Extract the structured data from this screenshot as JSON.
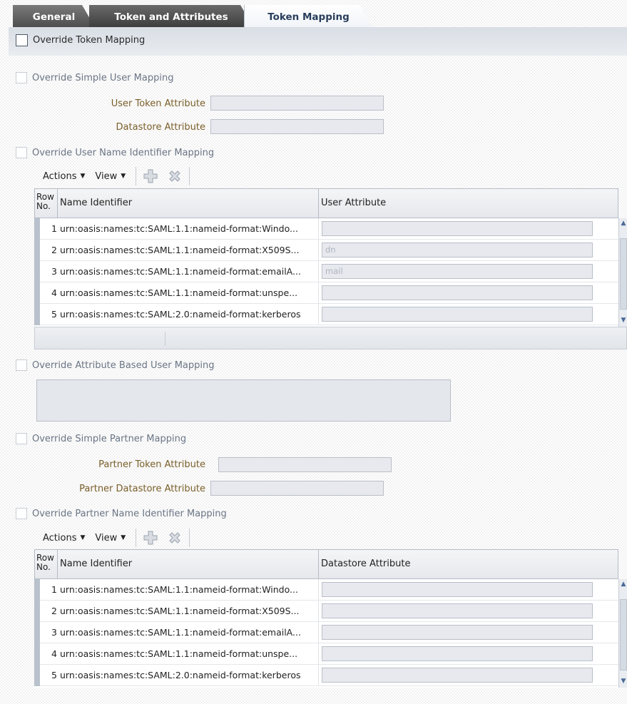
{
  "tabs": [
    {
      "label": "General"
    },
    {
      "label": "Token and Attributes"
    },
    {
      "label": "Token Mapping"
    }
  ],
  "override_token_mapping": {
    "label": "Override Token Mapping",
    "checked": false
  },
  "simple_user_mapping": {
    "label": "Override Simple User Mapping",
    "user_token_attribute_label": "User Token Attribute",
    "user_token_attribute_value": "",
    "datastore_attribute_label": "Datastore Attribute",
    "datastore_attribute_value": ""
  },
  "user_name_identifier_mapping": {
    "label": "Override User Name Identifier Mapping",
    "toolbar": {
      "actions": "Actions",
      "view": "View"
    },
    "columns": {
      "row_no": "Row No.",
      "name": "Name Identifier",
      "attr": "User Attribute"
    },
    "rows": [
      {
        "no": "1",
        "name": "urn:oasis:names:tc:SAML:1.1:nameid-format:Windo...",
        "value": ""
      },
      {
        "no": "2",
        "name": "urn:oasis:names:tc:SAML:1.1:nameid-format:X509S...",
        "value": "dn"
      },
      {
        "no": "3",
        "name": "urn:oasis:names:tc:SAML:1.1:nameid-format:emailA...",
        "value": "mail"
      },
      {
        "no": "4",
        "name": "urn:oasis:names:tc:SAML:1.1:nameid-format:unspe...",
        "value": ""
      },
      {
        "no": "5",
        "name": "urn:oasis:names:tc:SAML:2.0:nameid-format:kerberos",
        "value": ""
      }
    ]
  },
  "attribute_based_user_mapping": {
    "label": "Override Attribute Based User Mapping",
    "value": ""
  },
  "simple_partner_mapping": {
    "label": "Override Simple Partner Mapping",
    "partner_token_attribute_label": "Partner Token Attribute",
    "partner_token_attribute_value": "",
    "partner_datastore_attribute_label": "Partner Datastore Attribute",
    "partner_datastore_attribute_value": ""
  },
  "partner_name_identifier_mapping": {
    "label": "Override Partner Name Identifier Mapping",
    "toolbar": {
      "actions": "Actions",
      "view": "View"
    },
    "columns": {
      "row_no": "Row No.",
      "name": "Name Identifier",
      "attr": "Datastore Attribute"
    },
    "rows": [
      {
        "no": "1",
        "name": "urn:oasis:names:tc:SAML:1.1:nameid-format:Windo...",
        "value": ""
      },
      {
        "no": "2",
        "name": "urn:oasis:names:tc:SAML:1.1:nameid-format:X509S...",
        "value": ""
      },
      {
        "no": "3",
        "name": "urn:oasis:names:tc:SAML:1.1:nameid-format:emailA...",
        "value": ""
      },
      {
        "no": "4",
        "name": "urn:oasis:names:tc:SAML:1.1:nameid-format:unspe...",
        "value": ""
      },
      {
        "no": "5",
        "name": "urn:oasis:names:tc:SAML:2.0:nameid-format:kerberos",
        "value": ""
      }
    ]
  },
  "icons": {
    "add": "add-icon",
    "delete": "delete-icon",
    "dropdown": "chevron-down-icon"
  }
}
